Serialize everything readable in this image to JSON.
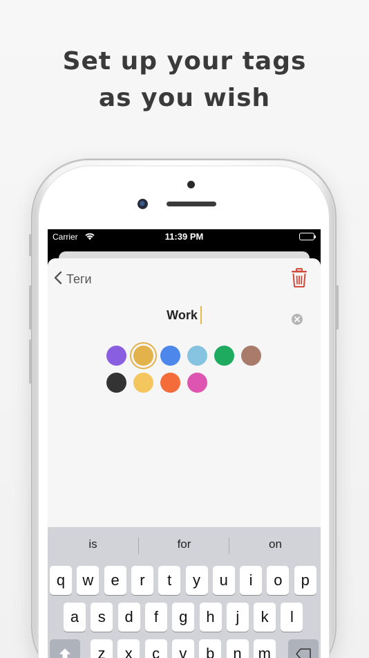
{
  "headline": [
    "Set up your tags",
    "as you wish"
  ],
  "status_bar": {
    "carrier": "Carrier",
    "time": "11:39 PM"
  },
  "nav": {
    "back_label": "Теги"
  },
  "tag_editor": {
    "name_value": "Work"
  },
  "colors": [
    {
      "hex": "#8a5ee0",
      "selected": false
    },
    {
      "hex": "#e3b24a",
      "selected": true
    },
    {
      "hex": "#4d87ec",
      "selected": false
    },
    {
      "hex": "#86c3e0",
      "selected": false
    },
    {
      "hex": "#1eab60",
      "selected": false
    },
    {
      "hex": "#a87b6b",
      "selected": false
    },
    {
      "hex": "#333333",
      "selected": false
    },
    {
      "hex": "#f4c75e",
      "selected": false
    },
    {
      "hex": "#f36c3a",
      "selected": false
    },
    {
      "hex": "#de55b1",
      "selected": false
    }
  ],
  "keyboard": {
    "suggestions": [
      "is",
      "for",
      "on"
    ],
    "row1": [
      "q",
      "w",
      "e",
      "r",
      "t",
      "y",
      "u",
      "i",
      "o",
      "p"
    ],
    "row2": [
      "a",
      "s",
      "d",
      "f",
      "g",
      "h",
      "j",
      "k",
      "l"
    ],
    "row3": [
      "z",
      "x",
      "c",
      "v",
      "b",
      "n",
      "m"
    ]
  }
}
